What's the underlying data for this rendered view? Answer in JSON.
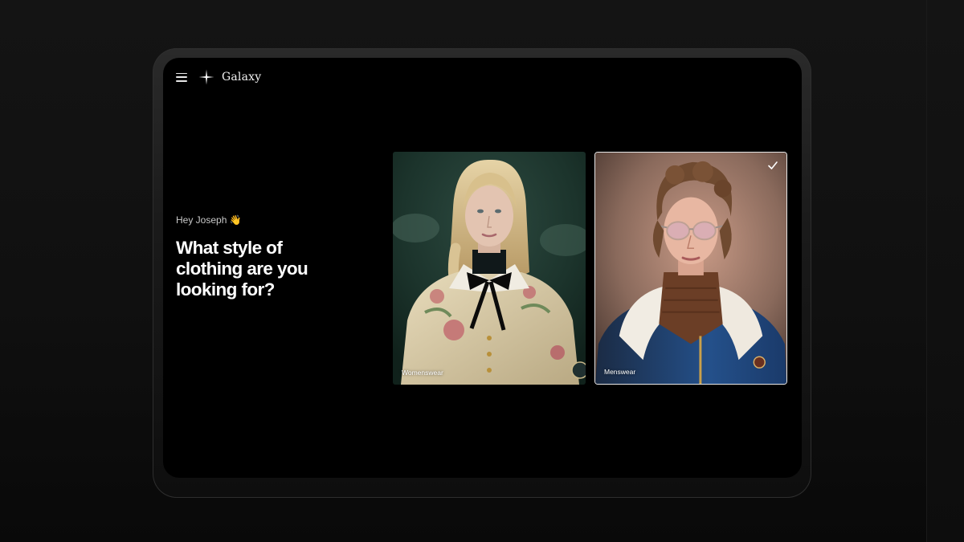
{
  "app": {
    "brand_name": "Galaxy"
  },
  "icons": {
    "menu": "menu-icon",
    "logo": "sparkle-star-icon",
    "selected": "check-icon"
  },
  "main": {
    "greeting": "Hey Joseph 👋",
    "question": "What style of clothing are you looking for?"
  },
  "options": [
    {
      "label": "Womenswear",
      "selected": false
    },
    {
      "label": "Menswear",
      "selected": true
    }
  ],
  "colors": {
    "background": "#000000",
    "text_primary": "#ffffff",
    "text_secondary": "#c9c9c9",
    "selection_border": "#e8e8e8"
  }
}
